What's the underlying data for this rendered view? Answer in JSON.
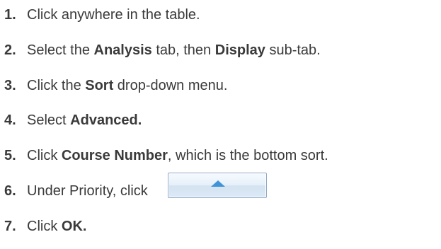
{
  "steps": [
    {
      "number": "1.",
      "parts": {
        "a": "Click anywhere in the table."
      }
    },
    {
      "number": "2.",
      "parts": {
        "a": "Select the ",
        "b": "Analysis",
        "c": " tab, then ",
        "d": "Display",
        "e": " sub-tab."
      }
    },
    {
      "number": "3.",
      "parts": {
        "a": "Click the ",
        "b": "Sort",
        "c": " drop-down menu."
      }
    },
    {
      "number": "4.",
      "parts": {
        "a": "Select ",
        "b": "Advanced."
      }
    },
    {
      "number": "5.",
      "parts": {
        "a": "Click ",
        "b": "Course Number",
        "c": ", which is the bottom sort."
      }
    },
    {
      "number": "6.",
      "parts": {
        "a": "Under Priority, click "
      },
      "button_icon": "up-arrow-icon"
    },
    {
      "number": "7.",
      "parts": {
        "a": "Click ",
        "b": "OK."
      }
    }
  ],
  "colors": {
    "text": "#3a3a3a",
    "button_border": "#8fa9c4",
    "arrow": "#3f93d6"
  }
}
